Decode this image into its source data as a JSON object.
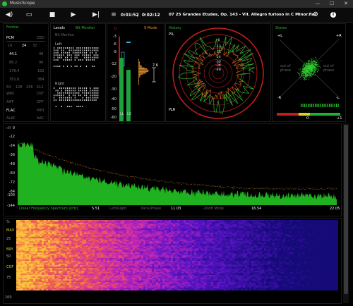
{
  "window": {
    "title": "MusicScope",
    "minimize": "—",
    "maximize": "☐",
    "close": "✕"
  },
  "toolbar": {
    "time_current": "0:01:52",
    "time_total": "0:02:12",
    "track_title": "07 25 Grandes Etudes, Op. 143 - VII. Allegro furioso in C Minor.flac"
  },
  "format": {
    "title": "Format",
    "pcm": "PCM",
    "dsd": "DSD",
    "bits": [
      "16",
      "24",
      "32"
    ],
    "rates_left": [
      "44.1",
      "88.2",
      "176.4",
      "352.8"
    ],
    "rates_right": [
      "48",
      "96",
      "192",
      "384"
    ],
    "dsd_rates": [
      "64",
      "128",
      "256",
      "512"
    ],
    "formats_left": [
      "WAV",
      "AIFF",
      "FLAC",
      "ALAC"
    ],
    "formats_right": [
      "DSF",
      "DFF",
      "MP3",
      "AAC"
    ]
  },
  "levels": {
    "title": "Levels",
    "mode": "Bit Monitor",
    "sub": "Bit Monitor",
    "left": "Left",
    "right": "Right"
  },
  "meter": {
    "mode": "S-Mode",
    "ticks": [
      "0",
      "-3",
      "-6",
      "-9",
      "-12",
      "-20",
      "-30",
      "-40",
      "-50",
      "-60"
    ],
    "l": "LL",
    "r": "LU",
    "peak": "7.6"
  },
  "history": {
    "title": "History",
    "pil": "PIL",
    "plr": "PLR",
    "rings": [
      "-6",
      "-12",
      "-18",
      "-24",
      "-30",
      "-36",
      "-48"
    ]
  },
  "stereo": {
    "title": "Stereo",
    "l": "+L",
    "r": "+R",
    "nl": "-L",
    "nr": "-R",
    "oop": "out of phase",
    "zero": "0",
    "plus": "+1"
  },
  "spectrum": {
    "db_label": "dB",
    "ticks": [
      "0",
      "-12",
      "-24",
      "-36",
      "-48",
      "-60",
      "-72",
      "-84",
      "-100",
      "-144"
    ],
    "xlabel": "Linear Frequency Spectrum [kHz]",
    "xticks": [
      "5.51",
      "11.03",
      "16.54",
      "22.05"
    ],
    "modes": [
      "Left/Right",
      "Pans/Phase",
      "-20dB Mode"
    ]
  },
  "spectrogram": {
    "labels": [
      "%",
      "MAX",
      "25",
      "BRY",
      "50",
      "COF",
      "75",
      "100"
    ]
  }
}
